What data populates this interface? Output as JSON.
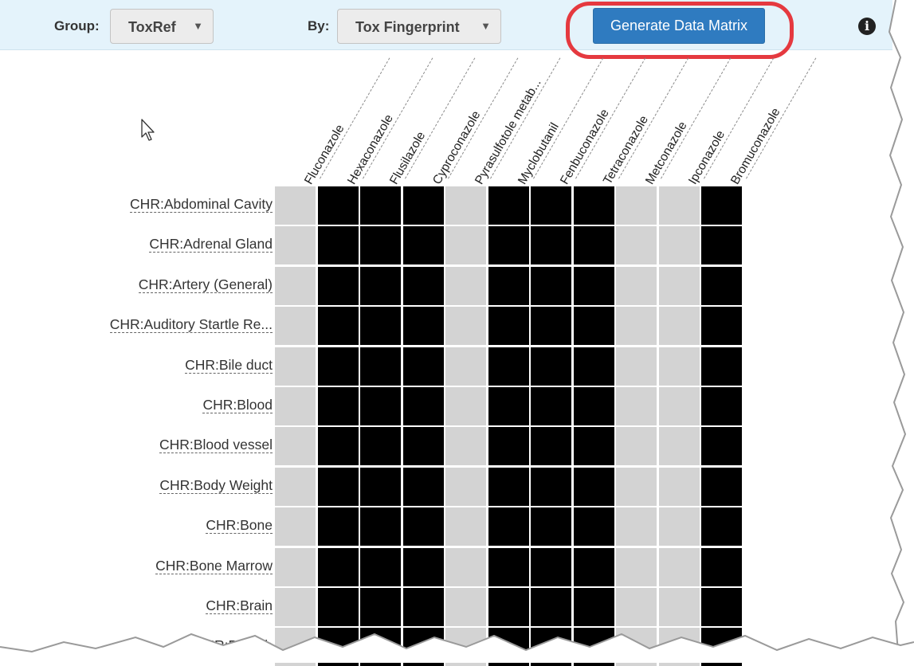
{
  "toolbar": {
    "group_label": "Group:",
    "group_value": "ToxRef",
    "by_label": "By:",
    "by_value": "Tox Fingerprint",
    "generate_label": "Generate Data Matrix",
    "info_glyph": "i",
    "caret_glyph": "▼"
  },
  "matrix": {
    "columns": [
      "Fluconazole",
      "Hexaconazole",
      "Flusilazole",
      "Cyproconazole",
      "Pyrasulfotole metab...",
      "Myclobutanil",
      "Fenbuconazole",
      "Tetraconazole",
      "Metconazole",
      "Ipconazole",
      "Bromuconazole"
    ],
    "column_pattern": [
      0,
      1,
      1,
      1,
      0,
      1,
      1,
      1,
      0,
      0,
      1
    ],
    "rows": [
      "CHR:Abdominal Cavity",
      "CHR:Adrenal Gland",
      "CHR:Artery (General)",
      "CHR:Auditory Startle Re...",
      "CHR:Bile duct",
      "CHR:Blood",
      "CHR:Blood vessel",
      "CHR:Body Weight",
      "CHR:Bone",
      "CHR:Bone Marrow",
      "CHR:Brain",
      "CHR:Bronch"
    ]
  },
  "colors": {
    "filled": "#000000",
    "empty": "#d3d3d3",
    "button": "#2f7bc0",
    "highlight": "#e5393f",
    "toolbar": "#e4f3fb"
  },
  "icons": {
    "cursor": "mouse-pointer-icon",
    "info": "info-icon",
    "dropdown": "chevron-down-icon"
  }
}
